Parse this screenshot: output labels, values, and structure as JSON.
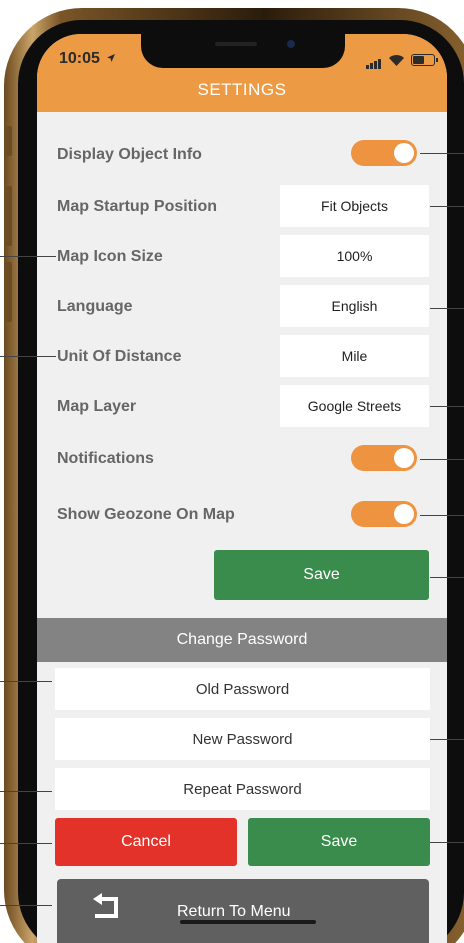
{
  "status_bar": {
    "time": "10:05"
  },
  "header": {
    "title": "SETTINGS"
  },
  "settings": {
    "display_object_info": {
      "label": "Display Object Info",
      "enabled": true
    },
    "map_startup_position": {
      "label": "Map Startup Position",
      "value": "Fit Objects"
    },
    "map_icon_size": {
      "label": "Map Icon Size",
      "value": "100%"
    },
    "language": {
      "label": "Language",
      "value": "English"
    },
    "unit_of_distance": {
      "label": "Unit Of Distance",
      "value": "Mile"
    },
    "map_layer": {
      "label": "Map Layer",
      "value": "Google Streets"
    },
    "notifications": {
      "label": "Notifications",
      "enabled": true
    },
    "show_geozone": {
      "label": "Show Geozone On Map",
      "enabled": true
    },
    "save_label": "Save"
  },
  "change_password": {
    "title": "Change Password",
    "old_placeholder": "Old Password",
    "new_placeholder": "New Password",
    "repeat_placeholder": "Repeat Password",
    "cancel_label": "Cancel",
    "save_label": "Save"
  },
  "return_menu": {
    "label": "Return To Menu"
  },
  "colors": {
    "accent": "#ec9a43",
    "toggle_on": "#ee9340",
    "save_green": "#3a8c4d",
    "cancel_red": "#e2322a",
    "section_gray": "#838383",
    "return_gray": "#606060"
  }
}
